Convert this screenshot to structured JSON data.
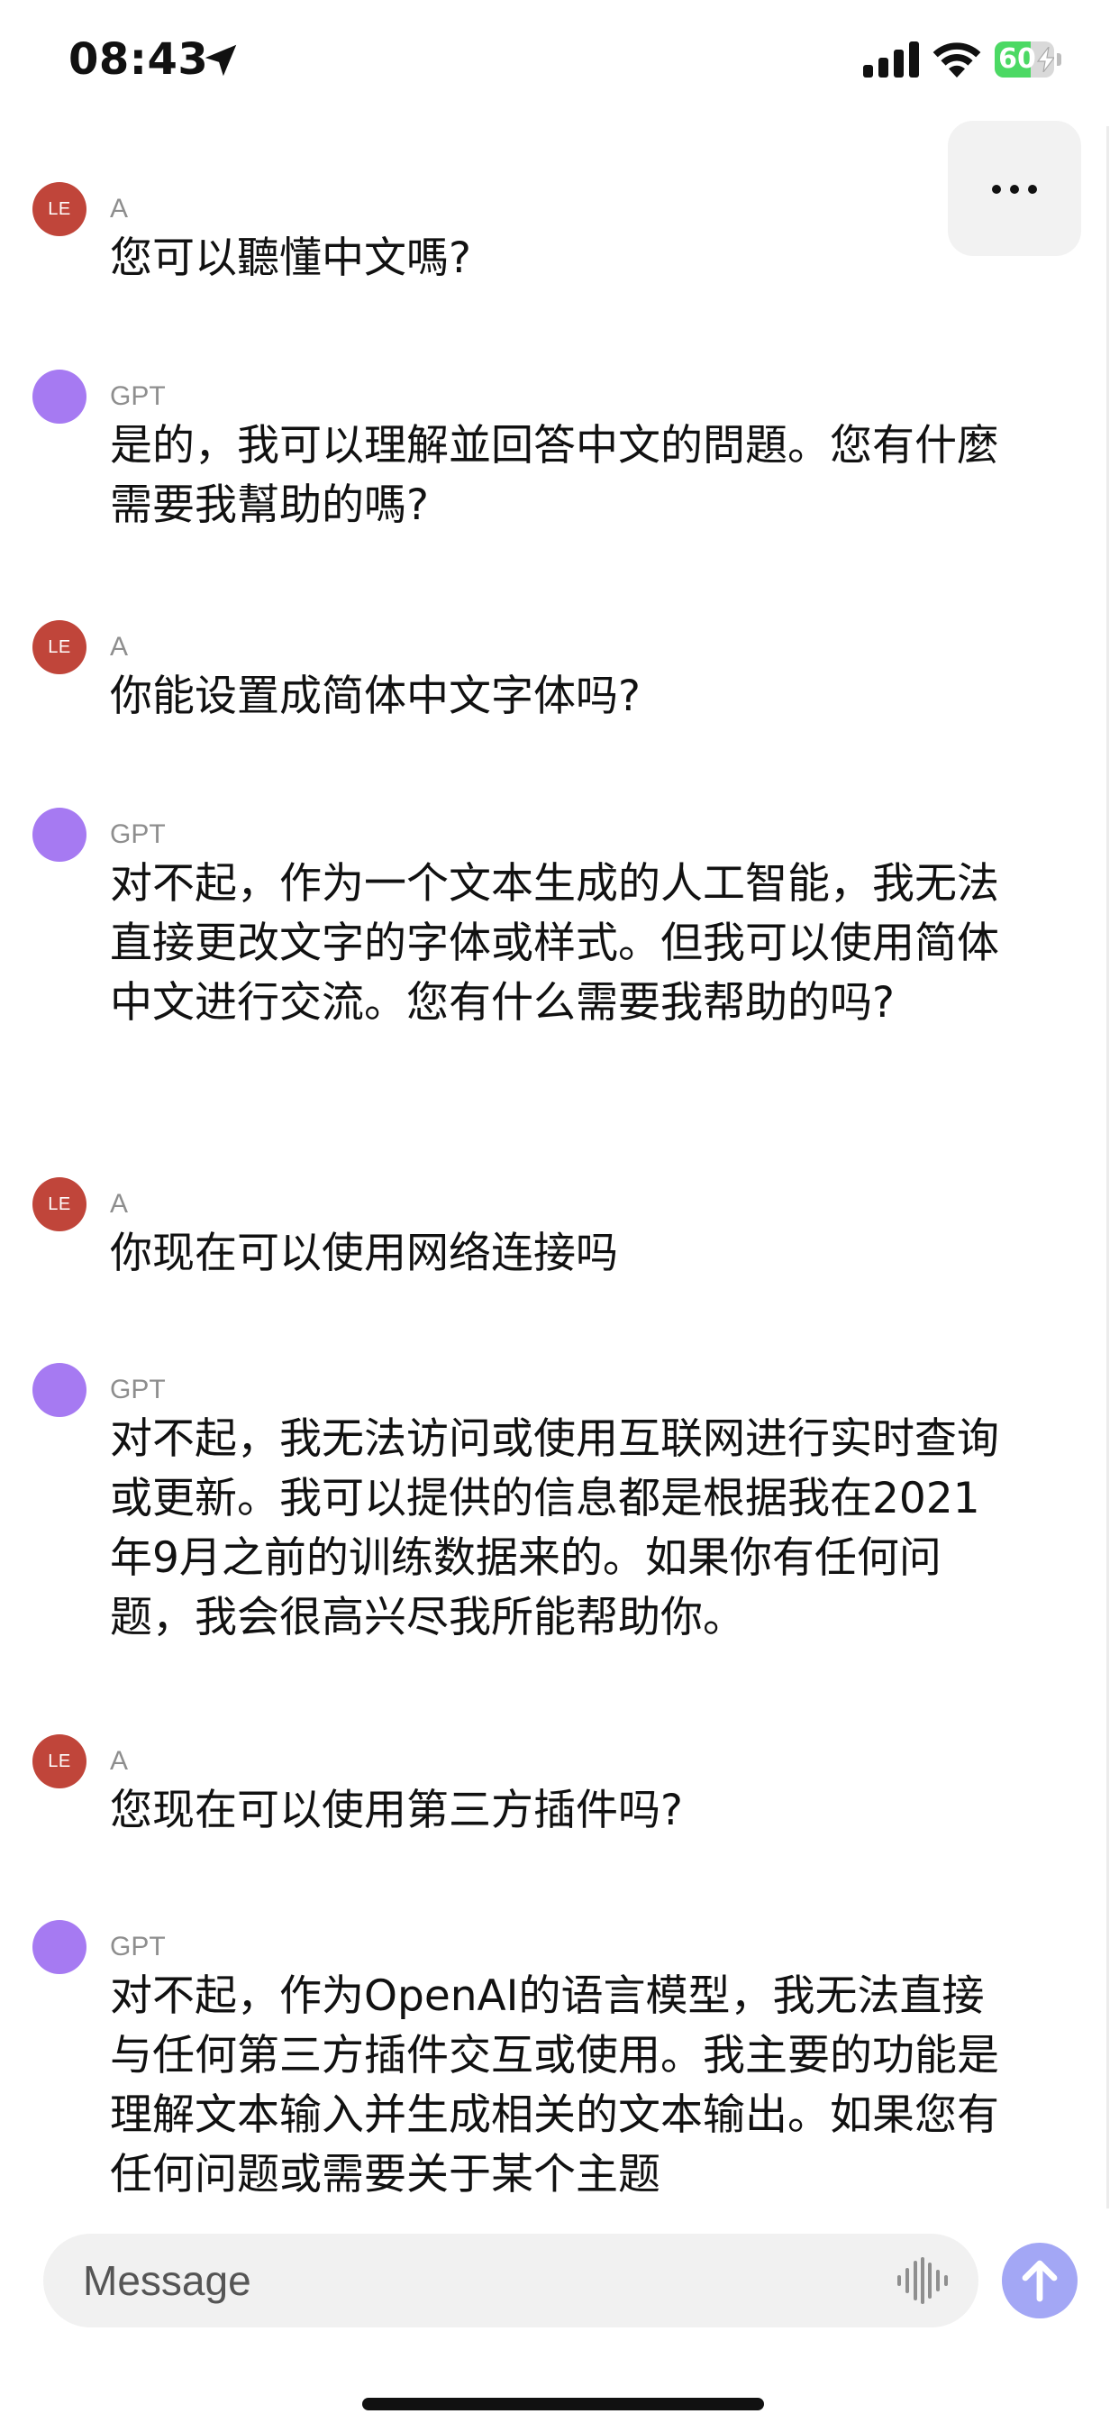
{
  "status_bar": {
    "time": "08:43",
    "battery_level": "60",
    "battery_fraction": 0.6,
    "icons": [
      "location-arrow-icon",
      "cellular-signal-icon",
      "wifi-icon",
      "battery-icon",
      "charging-bolt-icon"
    ]
  },
  "colors": {
    "user_avatar": "#c0453a",
    "gpt_avatar": "#a67af2",
    "send_button": "#a3a7f5",
    "battery_fill": "#4cd964"
  },
  "messages": [
    {
      "role": "user",
      "avatar_initials": "LE",
      "sender": "A",
      "text": "您可以聽懂中文嗎?"
    },
    {
      "role": "gpt",
      "avatar_initials": "",
      "sender": "GPT",
      "text": "是的，我可以理解並回答中文的問題。您有什麼需要我幫助的嗎?"
    },
    {
      "role": "user",
      "avatar_initials": "LE",
      "sender": "A",
      "text": "你能设置成简体中文字体吗?"
    },
    {
      "role": "gpt",
      "avatar_initials": "",
      "sender": "GPT",
      "text": "对不起，作为一个文本生成的人工智能，我无法直接更改文字的字体或样式。但我可以使用简体中文进行交流。您有什么需要我帮助的吗?"
    },
    {
      "role": "user",
      "avatar_initials": "LE",
      "sender": "A",
      "text": "你现在可以使用网络连接吗"
    },
    {
      "role": "gpt",
      "avatar_initials": "",
      "sender": "GPT",
      "text": "对不起，我无法访问或使用互联网进行实时查询或更新。我可以提供的信息都是根据我在2021年9月之前的训练数据来的。如果你有任何问题，我会很高兴尽我所能帮助你。"
    },
    {
      "role": "user",
      "avatar_initials": "LE",
      "sender": "A",
      "text": "您现在可以使用第三方插件吗?"
    },
    {
      "role": "gpt",
      "avatar_initials": "",
      "sender": "GPT",
      "text": "对不起，作为OpenAI的语言模型，我无法直接与任何第三方插件交互或使用。我主要的功能是理解文本输入并生成相关的文本输出。如果您有任何问题或需要关于某个主题"
    }
  ],
  "composer": {
    "placeholder": "Message",
    "voice_icon": "voice-waveform-icon",
    "send_icon": "arrow-up-icon"
  },
  "more_menu": {
    "icon": "more-dots-icon"
  }
}
